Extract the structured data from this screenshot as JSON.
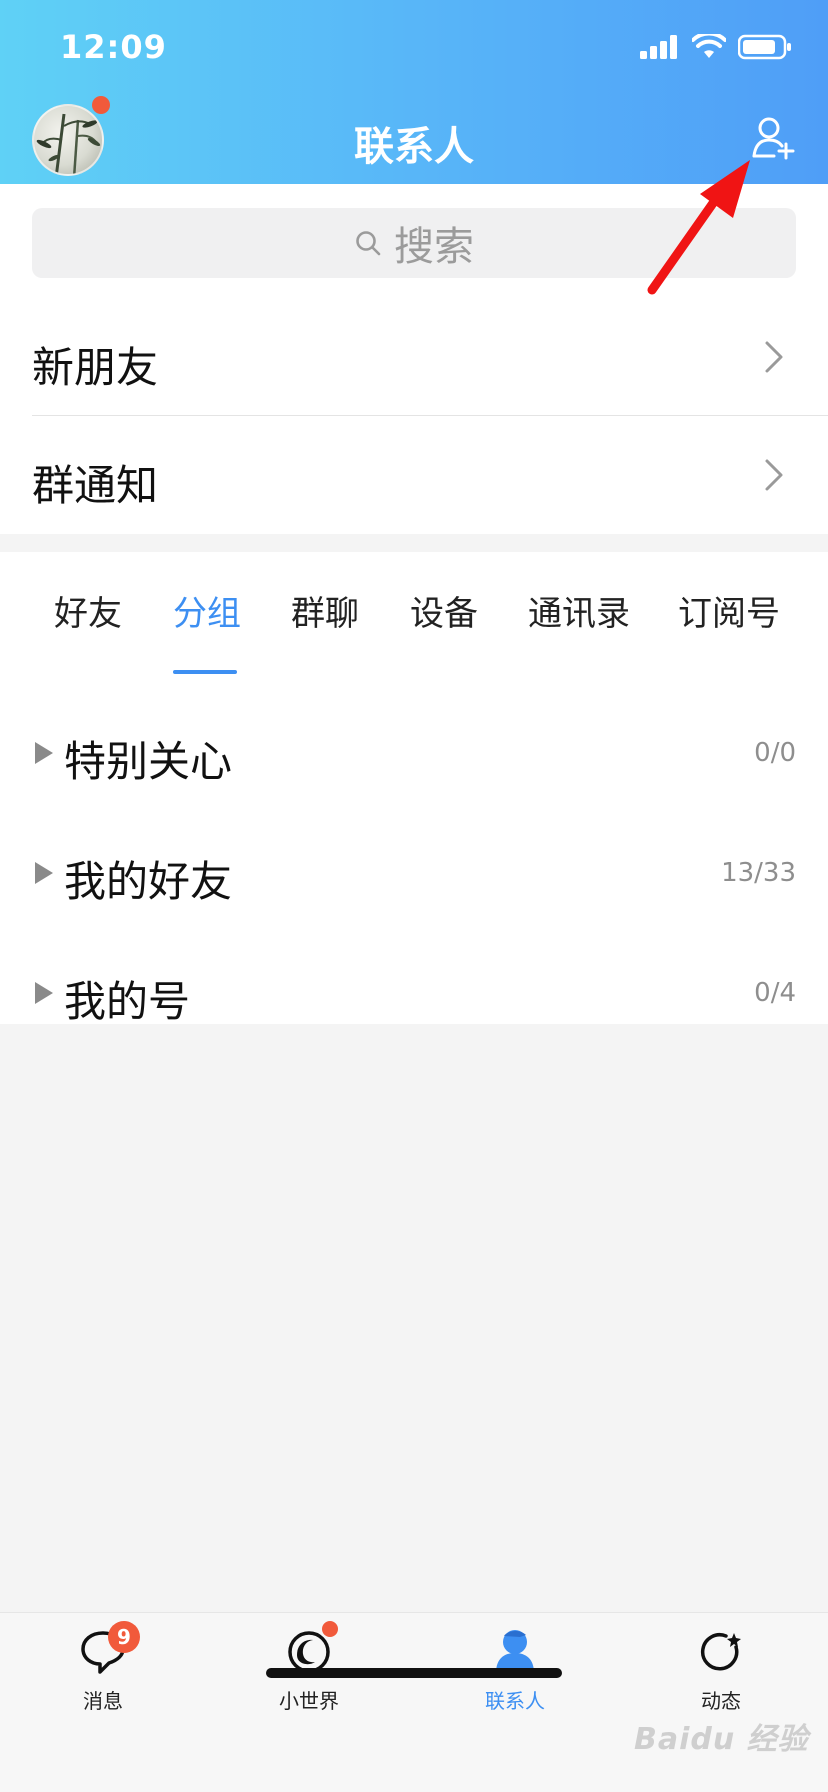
{
  "status": {
    "time": "12:09"
  },
  "header": {
    "title": "联系人"
  },
  "search": {
    "placeholder": "搜索"
  },
  "nav_rows": [
    {
      "label": "新朋友"
    },
    {
      "label": "群通知"
    }
  ],
  "tabs": [
    "好友",
    "分组",
    "群聊",
    "设备",
    "通讯录",
    "订阅号"
  ],
  "active_tab": "分组",
  "groups": [
    {
      "name": "特别关心",
      "count": "0/0"
    },
    {
      "name": "我的好友",
      "count": "13/33"
    },
    {
      "name": "我的号",
      "count": "0/4"
    }
  ],
  "tabbar": {
    "items": [
      {
        "label": "消息",
        "badge": "9",
        "icon": "message-bubble-icon"
      },
      {
        "label": "小世界",
        "icon": "small-world-icon"
      },
      {
        "label": "联系人",
        "icon": "contacts-person-icon",
        "active": true
      },
      {
        "label": "动态",
        "icon": "moments-star-icon"
      }
    ]
  },
  "colors": {
    "accent": "#3d8ff2",
    "badge": "#f15a3b",
    "annotation_arrow": "#f01414"
  },
  "watermark": "Baidu 经验"
}
